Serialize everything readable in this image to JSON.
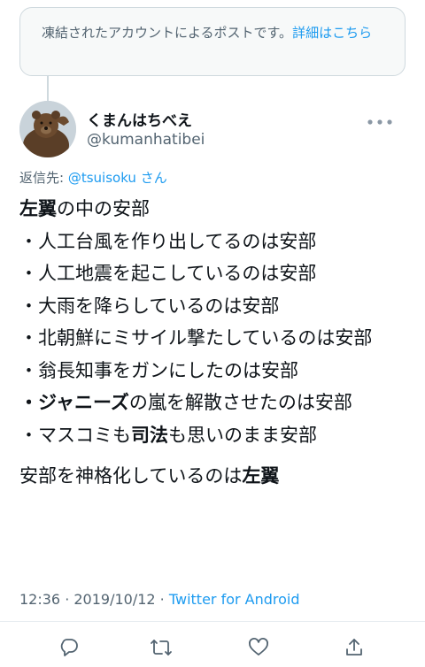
{
  "notice": {
    "text": "凍結されたアカウントによるポストです。",
    "link": "詳細はこちら"
  },
  "author": {
    "name": "くまんはちべえ",
    "handle": "@kumanhatibei",
    "avatar_icon": "bear-avatar",
    "more_icon": "more-dots-icon"
  },
  "reply": {
    "prefix": "返信先: ",
    "handle": "@tsuisoku",
    "suffix": " さん"
  },
  "tweet": {
    "line1_bold": "左翼",
    "line1_rest": "の中の安部",
    "lines": [
      "・人工台風を作り出してるのは安部",
      "・人工地震を起こしているのは安部",
      "・大雨を降らしているのは安部",
      "・北朝鮮にミサイル撃たしているのは安部",
      "・翁長知事をガンにしたのは安部"
    ],
    "johnnys_bullet": "・",
    "johnnys_bold": "ジャニーズ",
    "johnnys_rest": "の嵐を解散させたのは安部",
    "masukomi_a": "・マスコミも",
    "masukomi_bold": "司法",
    "masukomi_b": "も思いのまま安部",
    "closing_a": "安部を神格化しているのは",
    "closing_bold": "左翼"
  },
  "meta": {
    "time": "12:36",
    "sep": " · ",
    "date": "2019/10/12",
    "client": "Twitter for Android"
  },
  "actions": [
    "reply-icon",
    "retweet-icon",
    "like-icon",
    "share-icon"
  ],
  "colors": {
    "link": "#1d9bf0",
    "muted": "#536471",
    "text": "#0f1419"
  }
}
